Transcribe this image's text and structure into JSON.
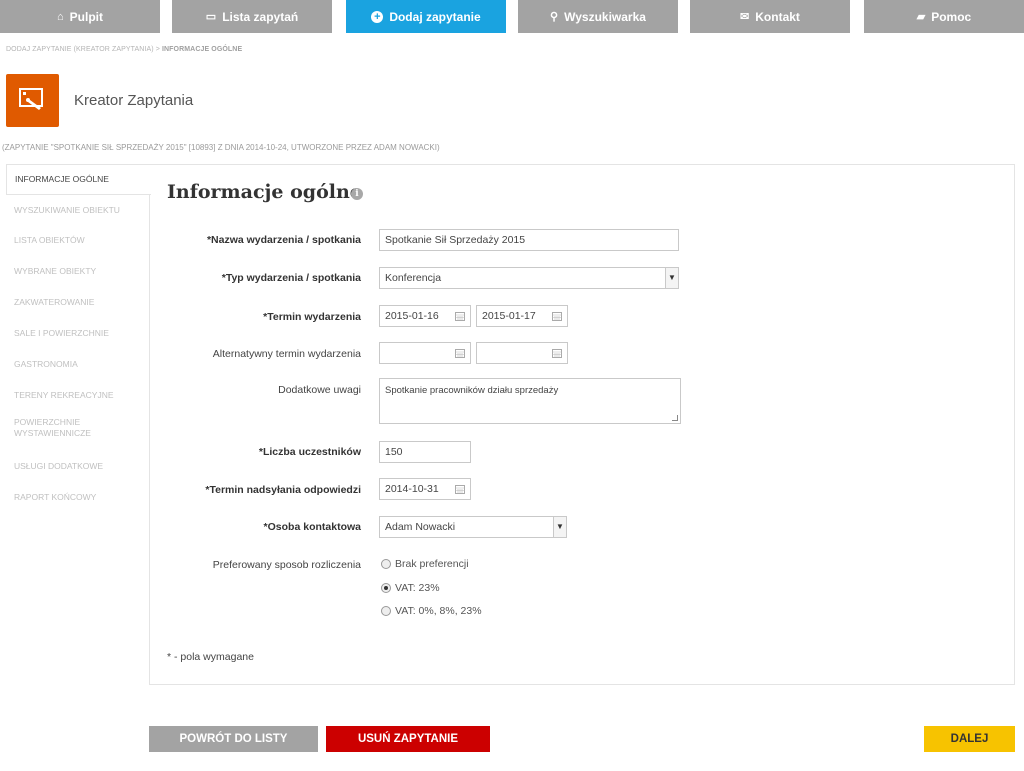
{
  "nav": {
    "items": [
      {
        "label": "Pulpit",
        "icon": "home-icon",
        "glyph": "⌂"
      },
      {
        "label": "Lista zapytań",
        "icon": "inbox-icon",
        "glyph": "▭"
      },
      {
        "label": "Dodaj zapytanie",
        "icon": "plus-circle-icon",
        "glyph": "+"
      },
      {
        "label": "Wyszukiwarka",
        "icon": "search-icon",
        "glyph": "⚲"
      },
      {
        "label": "Kontakt",
        "icon": "envelope-icon",
        "glyph": "✉"
      },
      {
        "label": "Pomoc",
        "icon": "book-icon",
        "glyph": "▰"
      }
    ],
    "active_color": "#1aa3e0",
    "inactive_color": "#a3a3a3"
  },
  "breadcrumb": {
    "parent": "DODAJ ZAPYTANIE (KREATOR ZAPYTANIA)",
    "separator": " > ",
    "current": "INFORMACJE OGÓLNE"
  },
  "app": {
    "title": "Kreator Zapytania",
    "logo_color": "#e05a00",
    "subtitle": "(ZAPYTANIE \"SPOTKANIE SIŁ SPRZEDAŻY 2015\" [10893] Z DNIA 2014-10-24, UTWORZONE PRZEZ ADAM NOWACKI)"
  },
  "sidebar": {
    "items": [
      {
        "label": "INFORMACJE OGÓLNE"
      },
      {
        "label": "WYSZUKIWANIE OBIEKTU"
      },
      {
        "label": "LISTA OBIEKTÓW"
      },
      {
        "label": "WYBRANE OBIEKTY"
      },
      {
        "label": "ZAKWATEROWANIE"
      },
      {
        "label": "SALE I POWIERZCHNIE"
      },
      {
        "label": "GASTRONOMIA"
      },
      {
        "label": "TERENY REKREACYJNE"
      },
      {
        "label": "POWIERZCHNIE WYSTAWIENNICZE"
      },
      {
        "label": "USŁUGI DODATKOWE"
      },
      {
        "label": "RAPORT KOŃCOWY"
      }
    ]
  },
  "form": {
    "heading": "Informacje ogólne",
    "info_glyph": "i",
    "event_name": {
      "label": "*Nazwa wydarzenia / spotkania",
      "value": "Spotkanie Sił Sprzedaży 2015"
    },
    "event_type": {
      "label": "*Typ wydarzenia / spotkania",
      "value": "Konferencja"
    },
    "event_date": {
      "label": "*Termin wydarzenia",
      "from": "2015-01-16",
      "to": "2015-01-17"
    },
    "alt_date": {
      "label": "Alternatywny termin wydarzenia",
      "from": "",
      "to": ""
    },
    "notes": {
      "label": "Dodatkowe uwagi",
      "value": "Spotkanie pracowników działu sprzedaży"
    },
    "participants": {
      "label": "*Liczba uczestników",
      "value": "150"
    },
    "deadline": {
      "label": "*Termin nadsyłania odpowiedzi",
      "value": "2014-10-31"
    },
    "contact": {
      "label": "*Osoba kontaktowa",
      "value": "Adam Nowacki"
    },
    "billing": {
      "label": "Preferowany sposob rozliczenia",
      "options": [
        "Brak preferencji",
        "VAT: 23%",
        "VAT: 0%, 8%, 23%"
      ],
      "selected": "VAT: 23%"
    },
    "required_note": "* - pola wymagane"
  },
  "actions": {
    "back": "POWRÓT DO LISTY",
    "delete": "USUŃ ZAPYTANIE",
    "next": "DALEJ"
  }
}
